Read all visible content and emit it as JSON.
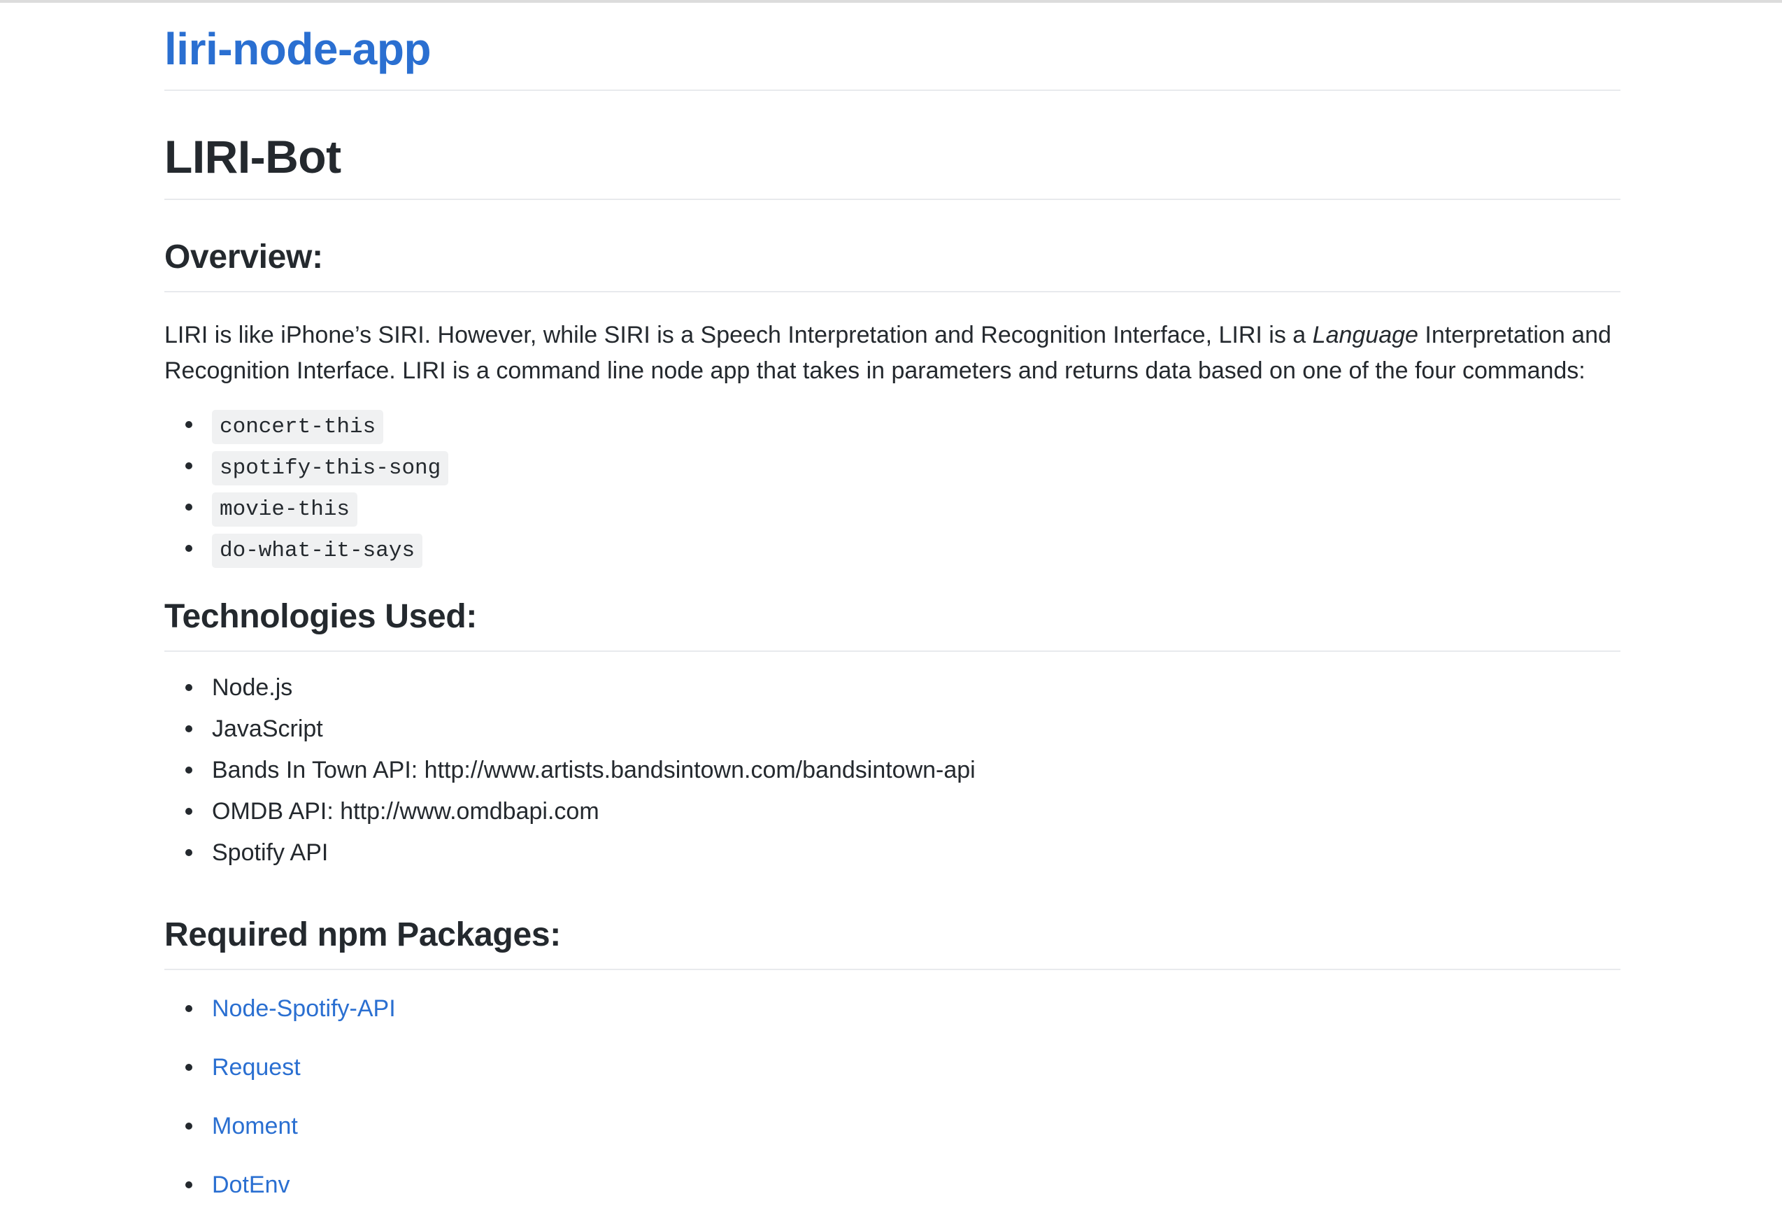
{
  "repo": {
    "title": "liri-node-app"
  },
  "readme": {
    "title": "LIRI-Bot",
    "overview": {
      "heading": "Overview:",
      "text_before": "LIRI is like iPhone’s SIRI. However, while SIRI is a Speech Interpretation and Recognition Interface, LIRI is a ",
      "emphasis": "Language",
      "text_after": " Interpretation and Recognition Interface. LIRI is a command line node app that takes in parameters and returns data based on one of the four commands:",
      "commands": [
        "concert-this",
        "spotify-this-song",
        "movie-this",
        "do-what-it-says"
      ]
    },
    "technologies": {
      "heading": "Technologies Used:",
      "items": [
        "Node.js",
        "JavaScript",
        "Bands In Town API: http://www.artists.bandsintown.com/bandsintown-api",
        "OMDB API: http://www.omdbapi.com",
        "Spotify API"
      ]
    },
    "packages": {
      "heading": "Required npm Packages:",
      "items": [
        "Node-Spotify-API",
        "Request",
        "Moment",
        "DotEnv"
      ]
    }
  },
  "colors": {
    "link": "#2a6fd1",
    "text": "#24292e",
    "rule": "#e8eaed",
    "code_bg": "#f0f1f2"
  }
}
